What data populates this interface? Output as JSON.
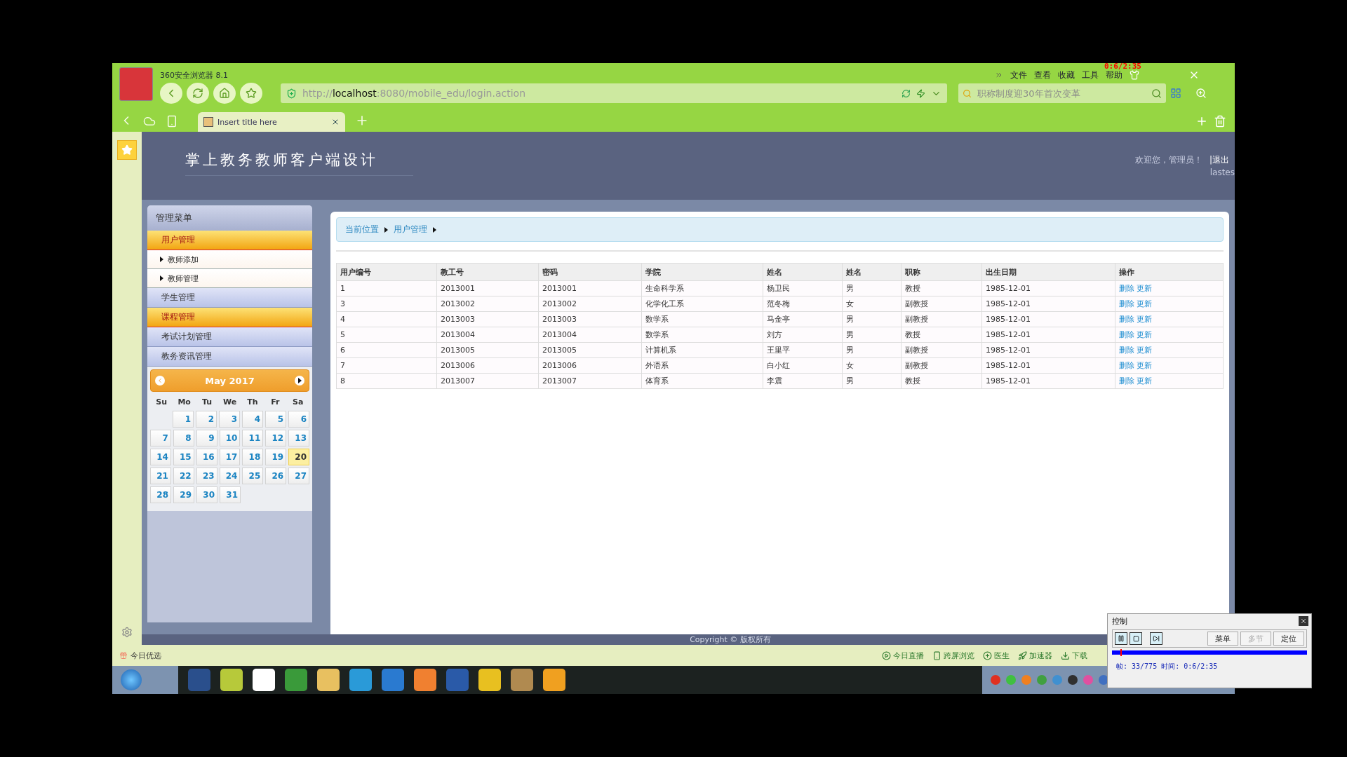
{
  "browser": {
    "title": "360安全浏览器 8.1",
    "menu": [
      "文件",
      "查看",
      "收藏",
      "工具",
      "帮助"
    ],
    "address": {
      "scheme": "http://",
      "host": "localhost",
      "path": ":8080/mobile_edu/login.action"
    },
    "search": {
      "placeholder": "职称制度迎30年首次变革"
    },
    "tabs": [
      {
        "label": "Insert title here",
        "selected": true
      }
    ]
  },
  "recorder_timer": "0:6/2:35",
  "header": {
    "title": "掌上教务教师客户端设计",
    "welcome": "欢迎您，管理员！",
    "logout": "|退出",
    "note": "lastes"
  },
  "sidebar": {
    "title": "管理菜单",
    "items": [
      {
        "label": "用户管理",
        "highlighted": true,
        "children": [
          {
            "label": "教师添加"
          },
          {
            "label": "教师管理"
          }
        ]
      },
      {
        "label": "学生管理",
        "highlighted": false
      },
      {
        "label": "课程管理",
        "highlighted": true
      },
      {
        "label": "考试计划管理",
        "highlighted": false
      },
      {
        "label": "教务资讯管理",
        "highlighted": false
      }
    ]
  },
  "calendar": {
    "month": "May 2017",
    "weekdays": [
      "Su",
      "Mo",
      "Tu",
      "We",
      "Th",
      "Fr",
      "Sa"
    ],
    "weeks": [
      [
        {
          "label": "1",
          "selected": false
        },
        {
          "label": "2",
          "selected": false
        },
        {
          "label": "3",
          "selected": false
        },
        {
          "label": "4",
          "selected": false
        },
        {
          "label": "5",
          "selected": false
        },
        {
          "label": "6",
          "selected": false
        }
      ],
      [
        {
          "label": "7",
          "selected": false
        },
        {
          "label": "8",
          "selected": false
        },
        {
          "label": "9",
          "selected": false
        },
        {
          "label": "10",
          "selected": false
        },
        {
          "label": "11",
          "selected": false
        },
        {
          "label": "12",
          "selected": false
        },
        {
          "label": "13",
          "selected": false
        }
      ],
      [
        {
          "label": "14",
          "selected": false
        },
        {
          "label": "15",
          "selected": false
        },
        {
          "label": "16",
          "selected": false
        },
        {
          "label": "17",
          "selected": false
        },
        {
          "label": "18",
          "selected": false
        },
        {
          "label": "19",
          "selected": false
        },
        {
          "label": "20",
          "selected": true
        }
      ],
      [
        {
          "label": "21",
          "selected": false
        },
        {
          "label": "22",
          "selected": false
        },
        {
          "label": "23",
          "selected": false
        },
        {
          "label": "24",
          "selected": false
        },
        {
          "label": "25",
          "selected": false
        },
        {
          "label": "26",
          "selected": false
        },
        {
          "label": "27",
          "selected": false
        }
      ],
      [
        {
          "label": "28",
          "selected": false
        },
        {
          "label": "29",
          "selected": false
        },
        {
          "label": "30",
          "selected": false
        },
        {
          "label": "31",
          "selected": false
        }
      ]
    ]
  },
  "breadcrumb": [
    "当前位置",
    "用户管理"
  ],
  "table": {
    "columns": [
      "用户编号",
      "教工号",
      "密码",
      "学院",
      "姓名",
      "姓名",
      "职称",
      "出生日期",
      "操作"
    ],
    "rows": [
      {
        "cells": [
          "1",
          "2013001",
          "2013001",
          "生命科学系",
          "杨卫民",
          "男",
          "教授",
          "1985-12-01"
        ],
        "actions": [
          "删除",
          "更新"
        ]
      },
      {
        "cells": [
          "3",
          "2013002",
          "2013002",
          "化学化工系",
          "范冬梅",
          "女",
          "副教授",
          "1985-12-01"
        ],
        "actions": [
          "删除",
          "更新"
        ]
      },
      {
        "cells": [
          "4",
          "2013003",
          "2013003",
          "数学系",
          "马金亭",
          "男",
          "副教授",
          "1985-12-01"
        ],
        "actions": [
          "删除",
          "更新"
        ]
      },
      {
        "cells": [
          "5",
          "2013004",
          "2013004",
          "数学系",
          "刘方",
          "男",
          "教授",
          "1985-12-01"
        ],
        "actions": [
          "删除",
          "更新"
        ]
      },
      {
        "cells": [
          "6",
          "2013005",
          "2013005",
          "计算机系",
          "王里平",
          "男",
          "副教授",
          "1985-12-01"
        ],
        "actions": [
          "删除",
          "更新"
        ]
      },
      {
        "cells": [
          "7",
          "2013006",
          "2013006",
          "外语系",
          "白小红",
          "女",
          "副教授",
          "1985-12-01"
        ],
        "actions": [
          "删除",
          "更新"
        ]
      },
      {
        "cells": [
          "8",
          "2013007",
          "2013007",
          "体育系",
          "李震",
          "男",
          "教授",
          "1985-12-01"
        ],
        "actions": [
          "删除",
          "更新"
        ]
      }
    ]
  },
  "footer": {
    "copyright": "Copyright © 版权所有"
  },
  "status_bar": {
    "left": "今日优选",
    "items": [
      {
        "kind": "play",
        "label": "今日直播"
      },
      {
        "kind": "phone",
        "label": "跨屏浏览"
      },
      {
        "kind": "plus",
        "label": "医生"
      },
      {
        "kind": "rocket",
        "label": "加速器"
      },
      {
        "kind": "download",
        "label": "下载"
      }
    ]
  },
  "control_panel": {
    "title": "控制",
    "buttons": [
      {
        "label": "菜单",
        "disabled": false
      },
      {
        "label": "多节",
        "disabled": true
      },
      {
        "label": "定位",
        "disabled": false
      }
    ],
    "progress": {
      "level": 0.043
    },
    "status": "帧: 33/775 时间: 0:6/2:35"
  }
}
